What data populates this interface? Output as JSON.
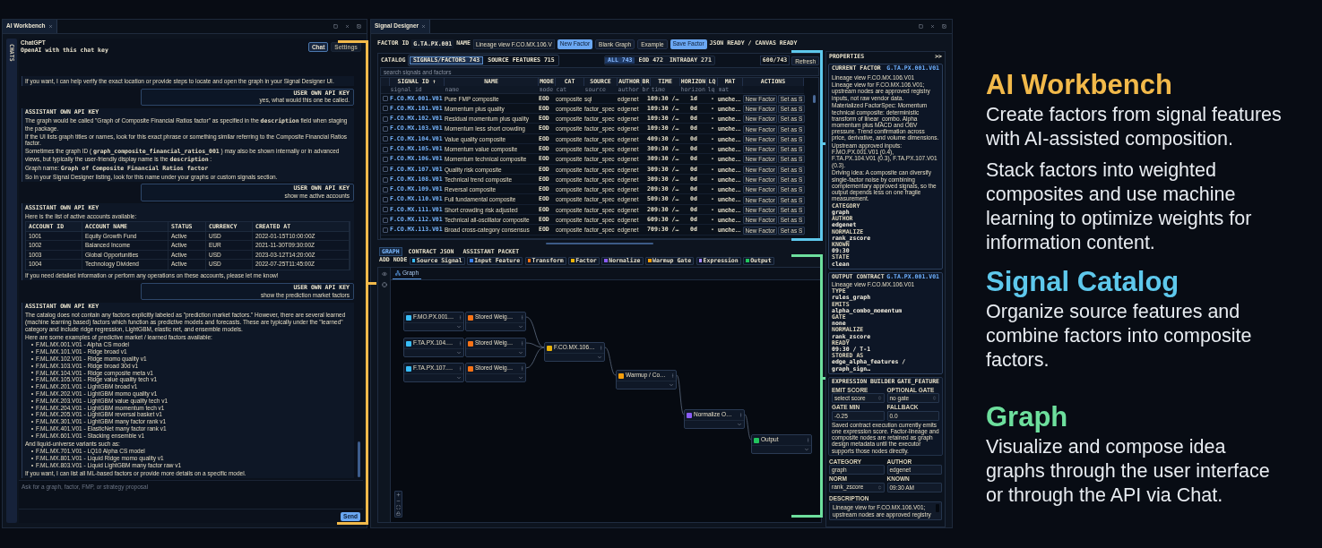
{
  "ai_workbench": {
    "tab_title": "AI Workbench",
    "sidebar_label": "CHATS",
    "provider": "ChatGPT",
    "key_mode": "OpenAI with this chat key",
    "header_buttons": [
      {
        "label": "Chat",
        "selected": true
      },
      {
        "label": "Settings",
        "selected": false
      }
    ],
    "messages": [
      {
        "kind": "assistant",
        "blocks": [
          {
            "kind": "p",
            "text": "If you want, I can help verify the exact location or provide steps to locate and open the graph in your Signal Designer UI."
          }
        ]
      },
      {
        "kind": "user",
        "heading": "USER OWN API KEY",
        "text": "yes, what would this one be called."
      },
      {
        "kind": "assistant",
        "heading": "ASSISTANT OWN API KEY",
        "blocks": [
          {
            "kind": "p",
            "text": "The graph would be called \"Graph of Composite Financial Ratios factor\" as specified in the **description** field when staging the package."
          },
          {
            "kind": "p",
            "text": "If the UI lists graph titles or names, look for this exact phrase or something similar referring to the Composite Financial Ratios factor."
          },
          {
            "kind": "p",
            "text": "Sometimes the graph ID ( **graph_composite_financial_ratios_001** ) may also be shown internally or in advanced views, but typically the user-friendly display name is the **description** :"
          },
          {
            "kind": "p",
            "text": "Graph name: **Graph of Composite Financial Ratios factor**"
          },
          {
            "kind": "p",
            "text": "So in your Signal Designer listing, look for this name under your graphs or custom signals section."
          }
        ]
      },
      {
        "kind": "user",
        "heading": "USER OWN API KEY",
        "text": "show me active accounts"
      },
      {
        "kind": "assistant",
        "heading": "ASSISTANT OWN API KEY",
        "blocks": [
          {
            "kind": "p",
            "text": "Here is the list of active accounts available:"
          },
          {
            "kind": "table",
            "columns": [
              "ACCOUNT ID",
              "ACCOUNT NAME",
              "STATUS",
              "CURRENCY",
              "CREATED AT"
            ],
            "rows": [
              [
                "1001",
                "Equity Growth Fund",
                "Active",
                "USD",
                "2022-01-15T10:00:00Z"
              ],
              [
                "1002",
                "Balanced Income",
                "Active",
                "EUR",
                "2021-11-30T09:30:00Z"
              ],
              [
                "1003",
                "Global Opportunities",
                "Active",
                "USD",
                "2023-03-12T14:20:00Z"
              ],
              [
                "1004",
                "Technology Dividend",
                "Active",
                "USD",
                "2022-07-25T11:45:00Z"
              ]
            ]
          },
          {
            "kind": "p",
            "text": "If you need detailed information or perform any operations on these accounts, please let me know!"
          }
        ]
      },
      {
        "kind": "user",
        "heading": "USER OWN API KEY",
        "text": "show the prediction market factors"
      },
      {
        "kind": "assistant",
        "heading": "ASSISTANT OWN API KEY",
        "blocks": [
          {
            "kind": "p",
            "text": "The catalog does not contain any factors explicitly labeled as \"prediction market factors.\" However, there are several learned (machine learning based) factors which function as predictive models and forecasts. These are typically under the \"learned\" category and include ridge regression, LightGBM, elastic net, and ensemble models."
          },
          {
            "kind": "p",
            "text": "Here are some examples of predictive market / learned factors available:"
          },
          {
            "kind": "list",
            "items": [
              "F.ML.MX.001.V01 - Alpha CS model",
              "F.ML.MX.101.V01 - Ridge broad v1",
              "F.ML.MX.102.V01 - Ridge momo quality v1",
              "F.ML.MX.103.V01 - Ridge broad 30d v1",
              "F.ML.MX.104.V01 - Ridge composite meta v1",
              "F.ML.MX.105.V01 - Ridge value quality tech v1",
              "F.ML.MX.201.V01 - LightGBM broad v1",
              "F.ML.MX.202.V01 - LightGBM momo quality v1",
              "F.ML.MX.203.V01 - LightGBM value quality tech v1",
              "F.ML.MX.204.V01 - LightGBM momentum tech v1",
              "F.ML.MX.205.V01 - LightGBM reversal basket v1",
              "F.ML.MX.301.V01 - LightGBM many factor rank v1",
              "F.ML.MX.401.V01 - ElasticNet many factor rank v1",
              "F.ML.MX.601.V01 - Stacking ensemble v1"
            ]
          },
          {
            "kind": "p",
            "text": "And liquid-universe variants such as:"
          },
          {
            "kind": "list",
            "items": [
              "F.ML.MX.701.V01 - LQ10 Alpha CS model",
              "F.ML.MX.801.V01 - Liquid Ridge momo quality v1",
              "F.ML.MX.803.V01 - Liquid LightGBM many factor raw v1"
            ]
          },
          {
            "kind": "p",
            "text": "If you want, I can list all ML-based factors or provide more details on a specific model."
          }
        ]
      }
    ],
    "composer": {
      "placeholder": "Ask for a graph, factor, FMP, or strategy proposal",
      "send_label": "Send"
    }
  },
  "signal_designer": {
    "tab_title": "Signal Designer",
    "toolbar": {
      "factor_id_label": "FACTOR ID",
      "factor_id": "G.TA.PX.001",
      "name_label": "NAME",
      "name_value": "Lineage view F.CO.MX.106.V",
      "buttons": [
        {
          "label": "New Factor",
          "primary": true
        },
        {
          "label": "Blank Graph",
          "primary": false
        },
        {
          "label": "Example",
          "primary": false
        },
        {
          "label": "Save Factor",
          "primary": true
        }
      ],
      "status": "JSON READY / CANVAS READY"
    },
    "catalog": {
      "label": "CATALOG",
      "tabs": [
        {
          "label": "SIGNALS/FACTORS 743",
          "selected": true
        },
        {
          "label": "SOURCE FEATURES 715",
          "selected": false
        }
      ],
      "filters": [
        {
          "label": "ALL 743",
          "selected": true
        },
        {
          "label": "EOD 472",
          "selected": false
        },
        {
          "label": "INTRADAY 271",
          "selected": false
        }
      ],
      "count": "600/743",
      "refresh_label": "Refresh",
      "search_placeholder": "search signals and factors",
      "columns": [
        "SIGNAL ID ↑",
        "NAME",
        "MODE",
        "CAT",
        "SOURCE",
        "AUTHOR",
        "BR",
        "TIME",
        "HORIZON",
        "LQ",
        "MAT",
        "ACTIONS"
      ],
      "column_filters": [
        {
          "placeholder": "signal id"
        },
        {
          "placeholder": "name"
        },
        {
          "placeholder": "mode"
        },
        {
          "placeholder": "cat"
        },
        {
          "placeholder": "source"
        },
        {
          "placeholder": "author"
        },
        {
          "placeholder": "br"
        },
        {
          "placeholder": "time"
        },
        {
          "placeholder": "horizon"
        },
        {
          "placeholder": "lq"
        },
        {
          "placeholder": "mat"
        }
      ],
      "rows": [
        {
          "checked": false,
          "id": "F.CO.MX.001.V01",
          "name": "Pure FMP composite",
          "mode": "EOD",
          "cat": "composite",
          "source": "sql",
          "author": "edgenet",
          "br": "1",
          "time": "09:30 /…",
          "horizon": "1d",
          "lq": "-",
          "mat": "unche…",
          "actions": [
            "New Factor",
            "Set as S"
          ]
        },
        {
          "checked": false,
          "id": "F.CO.MX.101.V01",
          "name": "Momentum plus quality",
          "mode": "EOD",
          "cat": "composite",
          "source": "factor_spec",
          "author": "edgenet",
          "br": "1",
          "time": "09:30 /…",
          "horizon": "0d",
          "lq": "-",
          "mat": "unche…",
          "actions": [
            "New Factor",
            "Set as S"
          ]
        },
        {
          "checked": false,
          "id": "F.CO.MX.102.V01",
          "name": "Residual momentum plus quality",
          "mode": "EOD",
          "cat": "composite",
          "source": "factor_spec",
          "author": "edgenet",
          "br": "1",
          "time": "09:30 /…",
          "horizon": "0d",
          "lq": "-",
          "mat": "unche…",
          "actions": [
            "New Factor",
            "Set as S"
          ]
        },
        {
          "checked": false,
          "id": "F.CO.MX.103.V01",
          "name": "Momentum less short crowding",
          "mode": "EOD",
          "cat": "composite",
          "source": "factor_spec",
          "author": "edgenet",
          "br": "1",
          "time": "09:30 /…",
          "horizon": "0d",
          "lq": "-",
          "mat": "unche…",
          "actions": [
            "New Factor",
            "Set as S"
          ]
        },
        {
          "checked": false,
          "id": "F.CO.MX.104.V01",
          "name": "Value quality composite",
          "mode": "EOD",
          "cat": "composite",
          "source": "factor_spec",
          "author": "edgenet",
          "br": "4",
          "time": "09:30 /…",
          "horizon": "0d",
          "lq": "-",
          "mat": "unche…",
          "actions": [
            "New Factor",
            "Set as S"
          ]
        },
        {
          "checked": false,
          "id": "F.CO.MX.105.V01",
          "name": "Momentum value composite",
          "mode": "EOD",
          "cat": "composite",
          "source": "factor_spec",
          "author": "edgenet",
          "br": "3",
          "time": "09:30 /…",
          "horizon": "0d",
          "lq": "-",
          "mat": "unche…",
          "actions": [
            "New Factor",
            "Set as S"
          ]
        },
        {
          "checked": false,
          "id": "F.CO.MX.106.V01",
          "name": "Momentum technical composite",
          "mode": "EOD",
          "cat": "composite",
          "source": "factor_spec",
          "author": "edgenet",
          "br": "3",
          "time": "09:30 /…",
          "horizon": "0d",
          "lq": "-",
          "mat": "unche…",
          "actions": [
            "New Factor",
            "Set as S"
          ]
        },
        {
          "checked": false,
          "id": "F.CO.MX.107.V01",
          "name": "Quality risk composite",
          "mode": "EOD",
          "cat": "composite",
          "source": "factor_spec",
          "author": "edgenet",
          "br": "3",
          "time": "09:30 /…",
          "horizon": "0d",
          "lq": "-",
          "mat": "unche…",
          "actions": [
            "New Factor",
            "Set as S"
          ]
        },
        {
          "checked": false,
          "id": "F.CO.MX.108.V01",
          "name": "Technical trend composite",
          "mode": "EOD",
          "cat": "composite",
          "source": "factor_spec",
          "author": "edgenet",
          "br": "3",
          "time": "09:30 /…",
          "horizon": "0d",
          "lq": "-",
          "mat": "unche…",
          "actions": [
            "New Factor",
            "Set as S"
          ]
        },
        {
          "checked": false,
          "id": "F.CO.MX.109.V01",
          "name": "Reversal composite",
          "mode": "EOD",
          "cat": "composite",
          "source": "factor_spec",
          "author": "edgenet",
          "br": "2",
          "time": "09:30 /…",
          "horizon": "0d",
          "lq": "-",
          "mat": "unche…",
          "actions": [
            "New Factor",
            "Set as S"
          ]
        },
        {
          "checked": false,
          "id": "F.CO.MX.110.V01",
          "name": "Full fundamental composite",
          "mode": "EOD",
          "cat": "composite",
          "source": "factor_spec",
          "author": "edgenet",
          "br": "5",
          "time": "09:30 /…",
          "horizon": "0d",
          "lq": "-",
          "mat": "unche…",
          "actions": [
            "New Factor",
            "Set as S"
          ]
        },
        {
          "checked": false,
          "id": "F.CO.MX.111.V01",
          "name": "Short crowding risk adjusted",
          "mode": "EOD",
          "cat": "composite",
          "source": "factor_spec",
          "author": "edgenet",
          "br": "2",
          "time": "09:30 /…",
          "horizon": "0d",
          "lq": "-",
          "mat": "unche…",
          "actions": [
            "New Factor",
            "Set as S"
          ]
        },
        {
          "checked": false,
          "id": "F.CO.MX.112.V01",
          "name": "Technical all-oscillator composite",
          "mode": "EOD",
          "cat": "composite",
          "source": "factor_spec",
          "author": "edgenet",
          "br": "6",
          "time": "09:30 /…",
          "horizon": "0d",
          "lq": "-",
          "mat": "unche…",
          "actions": [
            "New Factor",
            "Set as S"
          ]
        },
        {
          "checked": false,
          "id": "F.CO.MX.113.V01",
          "name": "Broad cross-category consensus",
          "mode": "EOD",
          "cat": "composite",
          "source": "factor_spec",
          "author": "edgenet",
          "br": "7",
          "time": "09:30 /…",
          "horizon": "0d",
          "lq": "-",
          "mat": "unche…",
          "actions": [
            "New Factor",
            "Set as S"
          ]
        }
      ]
    },
    "lower_tabs": [
      {
        "label": "GRAPH",
        "selected": true
      },
      {
        "label": "CONTRACT JSON",
        "selected": false
      },
      {
        "label": "ASSISTANT PACKET",
        "selected": false
      }
    ],
    "add_node": {
      "label": "ADD NODE",
      "types": [
        {
          "label": "Source Signal",
          "color": "#38bdf8"
        },
        {
          "label": "Input Feature",
          "color": "#3b82f6"
        },
        {
          "label": "Transform",
          "color": "#f97316"
        },
        {
          "label": "Factor",
          "color": "#eab308"
        },
        {
          "label": "Normalize",
          "color": "#8b5cf6"
        },
        {
          "label": "Warmup Gate",
          "color": "#f59e0b"
        },
        {
          "label": "Expression",
          "color": "#a78bfa"
        },
        {
          "label": "Output",
          "color": "#22c55e"
        }
      ]
    },
    "graph": {
      "tab_label": "Graph",
      "nodes": [
        {
          "label": "F.MO.PX.001…",
          "color": "#38bdf8"
        },
        {
          "label": "Stored Weig…",
          "color": "#f97316"
        },
        {
          "label": "F.TA.PX.104.…",
          "color": "#38bdf8"
        },
        {
          "label": "Stored Weig…",
          "color": "#f97316"
        },
        {
          "label": "F.TA.PX.107.…",
          "color": "#38bdf8"
        },
        {
          "label": "Stored Weig…",
          "color": "#f97316"
        },
        {
          "label": "F.CO.MX.106…",
          "color": "#eab308"
        },
        {
          "label": "Warmup / Co…",
          "color": "#f59e0b"
        },
        {
          "label": "Normalize O…",
          "color": "#8b5cf6"
        },
        {
          "label": "Output",
          "color": "#22c55e"
        }
      ]
    },
    "properties": {
      "title": "PROPERTIES",
      "toggle": ">>",
      "current_factor": {
        "title": "CURRENT FACTOR",
        "id": "G.TA.PX.001.V01",
        "name": "Lineage view F.CO.MX.106.V01",
        "paragraphs": [
          "Lineage view for F.CO.MX.106.V01; upstream nodes are approved registry inputs, not raw vendor data.",
          "Materialized FactorSpec: Momentum technical composite: deterministic transform of linear_combo. Alpha momentum plus MACD and OBV pressure. Trend confirmation across price, derivative, and volume dimensions.",
          "Upstream approved inputs: F.MO.PX.001.V01 (0.4), F.TA.PX.104.V01 (0.3), F.TA.PX.107.V01 (0.3).",
          "Driving idea: A composite can diversify single-factor noise by combining complementary approved signals, so the output depends less on one fragile measurement."
        ],
        "fields": [
          {
            "label": "CATEGORY",
            "value": "graph"
          },
          {
            "label": "AUTHOR",
            "value": "edgenet"
          },
          {
            "label": "NORMALIZE",
            "value": "rank_zscore"
          },
          {
            "label": "KNOWN",
            "value": "09:30"
          },
          {
            "label": "STATE",
            "value": "clean"
          }
        ]
      },
      "output_contract": {
        "title": "OUTPUT CONTRACT",
        "id": "G.TA.PX.001.V01",
        "name": "Lineage view F.CO.MX.106.V01",
        "fields": [
          {
            "label": "TYPE",
            "value": "rules_graph"
          },
          {
            "label": "EMITS",
            "value": "alpha_combo_momentum"
          },
          {
            "label": "GATE",
            "value": "none"
          },
          {
            "label": "NORMALIZE",
            "value": "rank_zscore"
          },
          {
            "label": "READY",
            "value": "09:30 / T-1"
          },
          {
            "label": "STORED AS",
            "value": "edge_alpha_features / graph_sign…"
          }
        ]
      },
      "expression_builder": {
        "title": "EXPRESSION BUILDER",
        "mode": "GATE_FEATURE",
        "inputs": [
          {
            "label": "EMIT SCORE",
            "value": "select score",
            "kind": "select"
          },
          {
            "label": "OPTIONAL GATE",
            "value": "no gate",
            "kind": "select"
          },
          {
            "label": "GATE MIN",
            "value": "-0.25",
            "kind": "input"
          },
          {
            "label": "FALLBACK",
            "value": "0.0",
            "kind": "input"
          }
        ],
        "note": "Saved contract execution currently emits one expression score. Factor-lineage and composite nodes are retained as graph design metadata until the executor supports those nodes directly."
      },
      "fields": [
        {
          "label": "CATEGORY",
          "value": "graph",
          "kind": "input"
        },
        {
          "label": "AUTHOR",
          "value": "edgenet",
          "kind": "input"
        },
        {
          "label": "NORM",
          "value": "rank_zscore",
          "kind": "select"
        },
        {
          "label": "KNOWN",
          "value": "09:30 AM",
          "kind": "input"
        }
      ],
      "description": {
        "label": "DESCRIPTION",
        "value": "Lineage view for F.CO.MX.106.V01; upstream nodes are approved registry"
      }
    }
  },
  "features": [
    {
      "title": "AI Workbench",
      "color": "#f2b94a",
      "paragraphs": [
        "Create factors from signal features with AI-assisted composition.",
        "Stack factors into weighted composites and use machine learning to optimize weights for information content."
      ]
    },
    {
      "title": "Signal Catalog",
      "color": "#5ec8ec",
      "paragraphs": [
        "Organize source features and combine factors into composite factors."
      ]
    },
    {
      "title": "Graph",
      "color": "#6ddf9d",
      "paragraphs": [
        "Visualize and compose idea graphs through the user interface or through the API via Chat."
      ]
    }
  ]
}
